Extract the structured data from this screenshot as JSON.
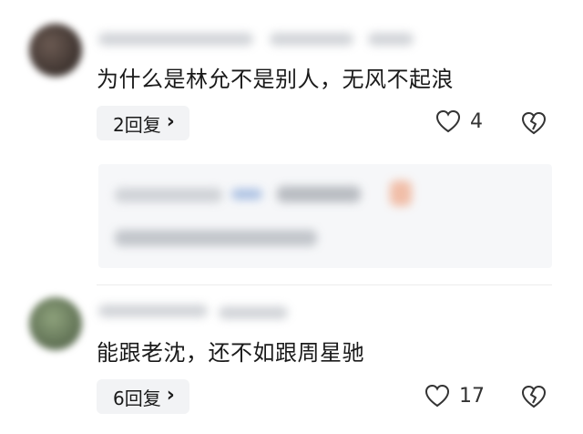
{
  "comments": [
    {
      "text": "为什么是林允不是别人，无风不起浪",
      "reply_label": "2回复",
      "reply_chevron": "›",
      "like_count": "4",
      "icons": {
        "like": "heart-outline-icon",
        "dislike": "broken-heart-icon"
      }
    },
    {
      "text": "能跟老沈，还不如跟周星驰",
      "reply_label": "6回复",
      "reply_chevron": "›",
      "like_count": "17",
      "icons": {
        "like": "heart-outline-icon",
        "dislike": "broken-heart-icon"
      }
    }
  ],
  "colors": {
    "pill_background": "#f2f3f5",
    "quoted_background": "#f6f7f9",
    "text": "#1a1a1a",
    "icon": "#333333"
  }
}
